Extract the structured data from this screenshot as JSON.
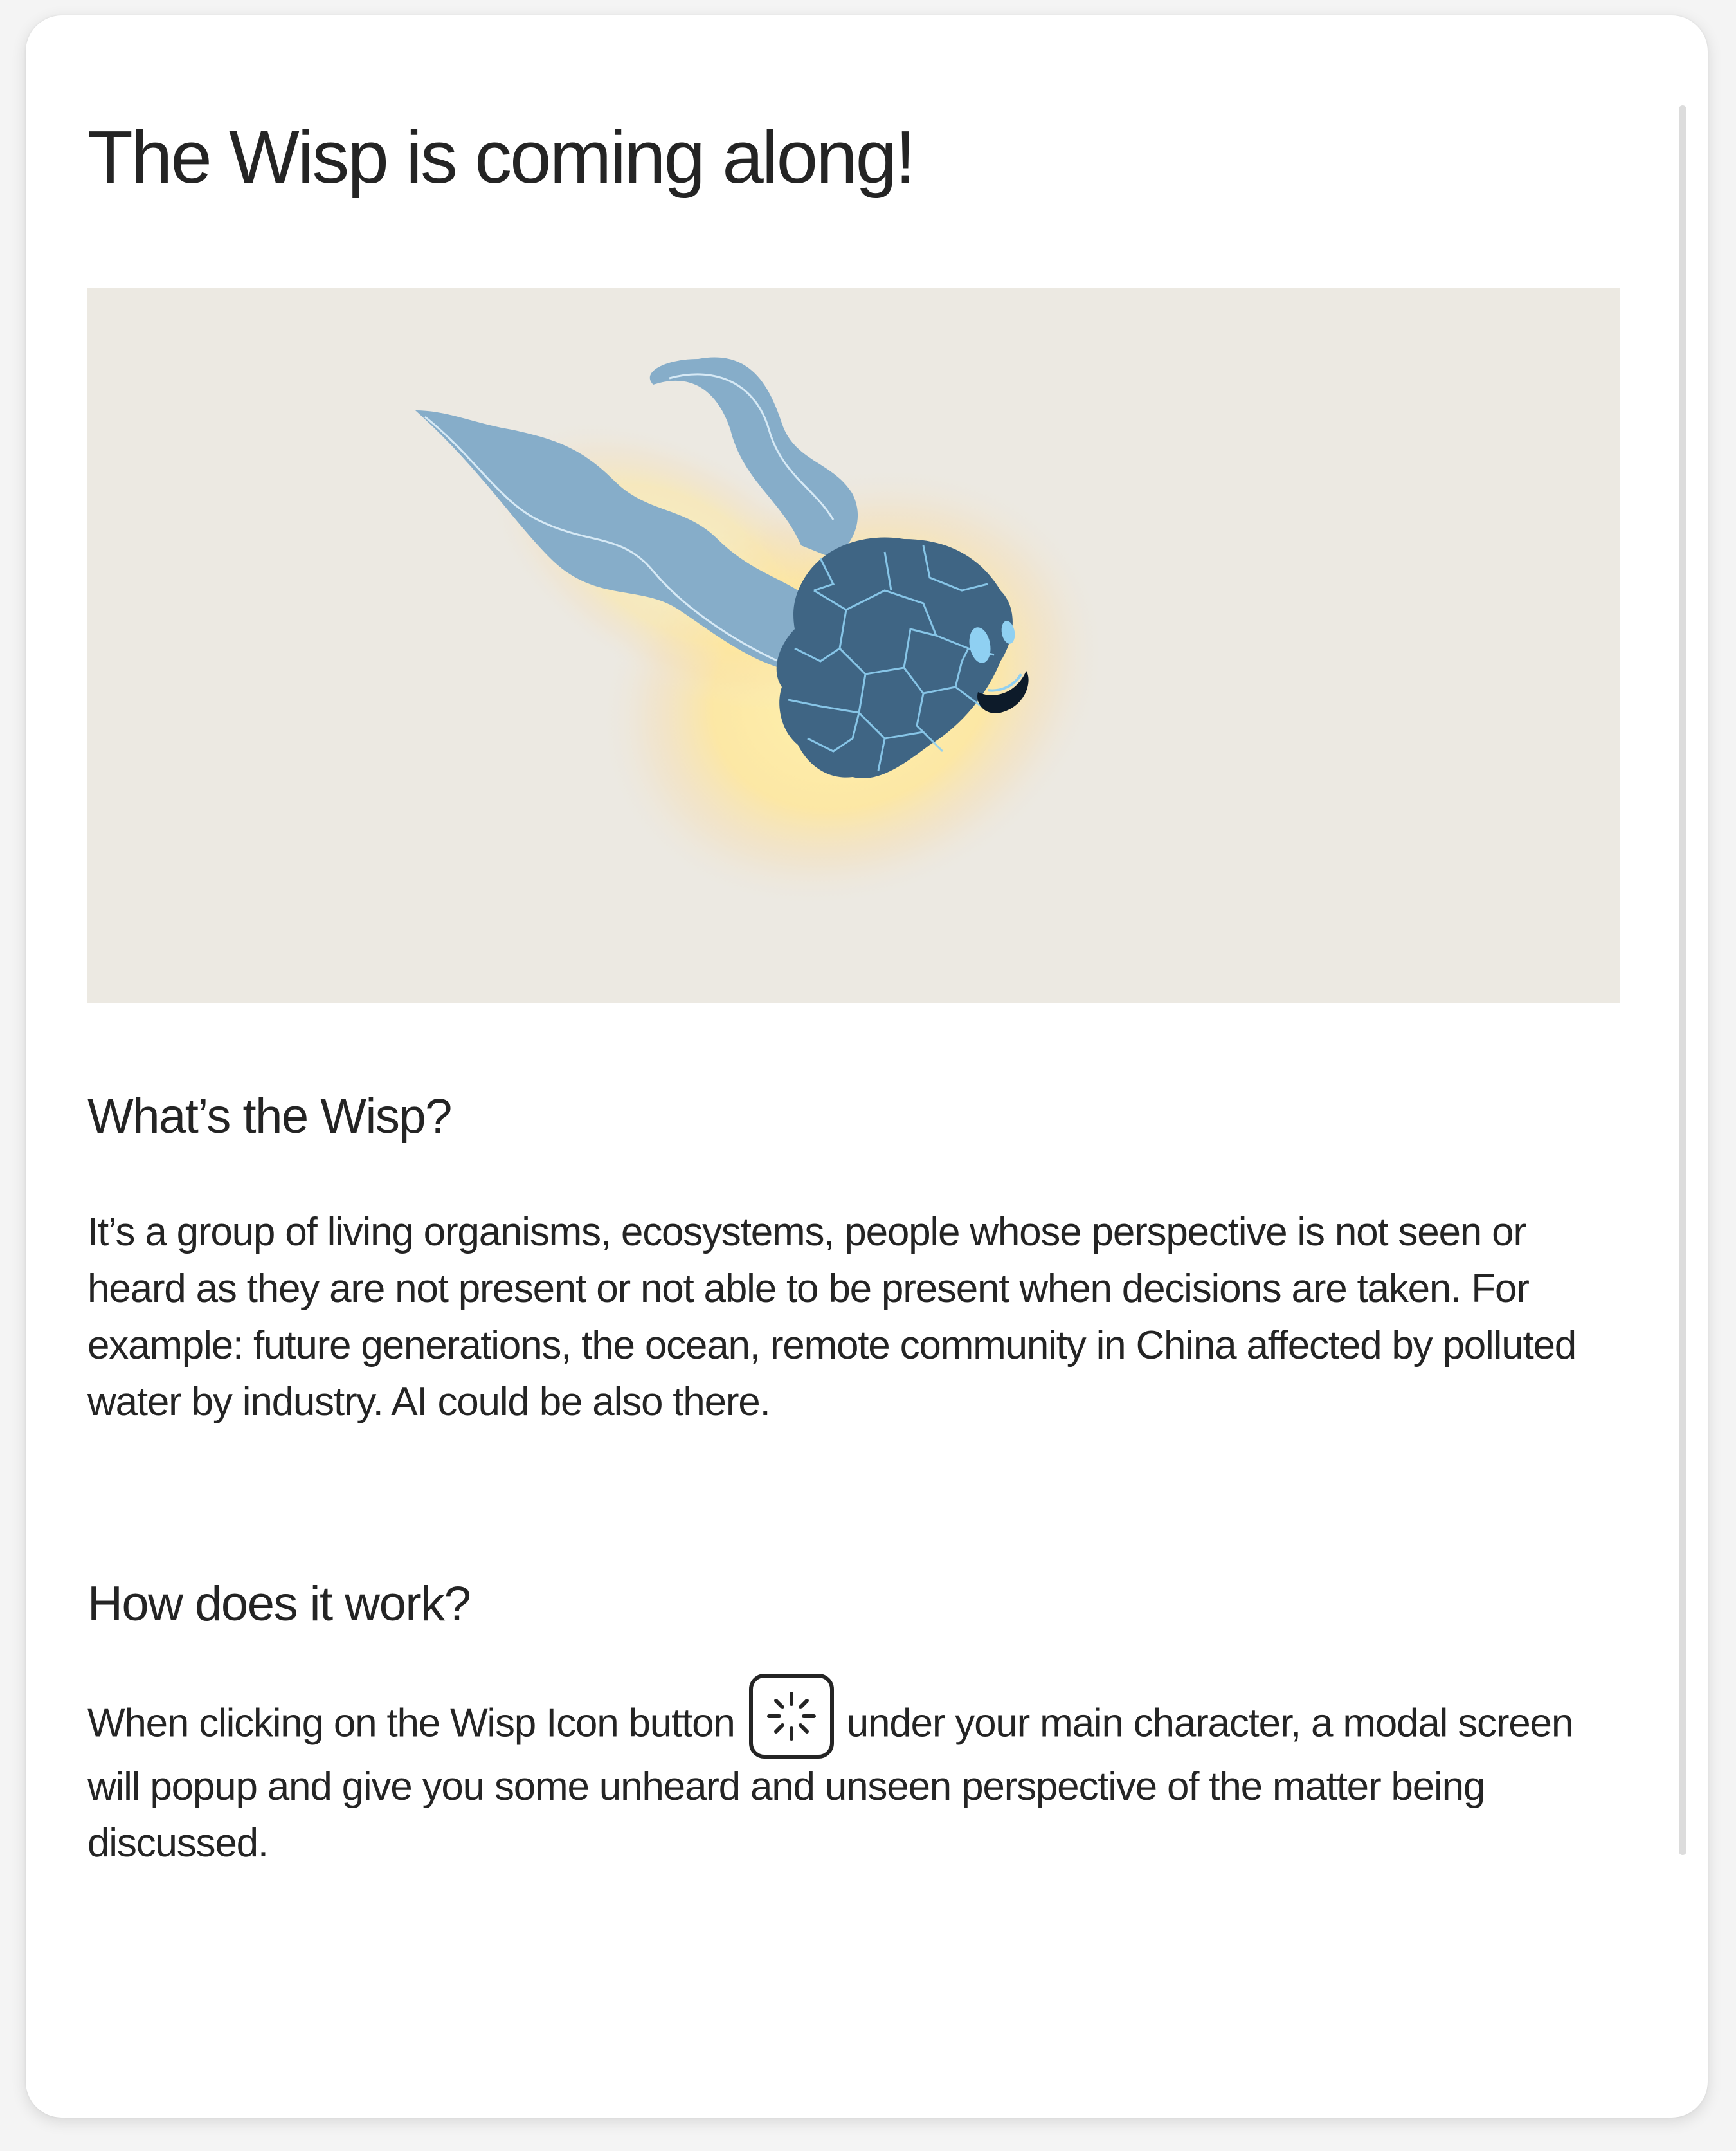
{
  "modal": {
    "title": "The Wisp is coming along!",
    "hero_image": {
      "icon": "wisp-illustration",
      "colors": {
        "background": "#ece9e2",
        "body": "#3f6584",
        "veins": "#8fd0f2",
        "tendrils": "#86adc9",
        "glow": "#fff0a8"
      }
    },
    "section_what": {
      "heading": "What’s the Wisp?",
      "body": "It’s a group of living organisms, ecosystems, people whose perspective is not seen or heard as they are not present or not able to be present when decisions are taken. For example: future generations, the ocean, remote community in China affected by polluted water by industry. AI could be also there."
    },
    "section_how": {
      "heading": "How does it work?",
      "body_before": "When clicking on the Wisp Icon button",
      "button_icon": "wisp-sparkle-icon",
      "body_after": "under your main character, a modal screen will popup and give you some unheard and unseen perspective of the matter being discussed."
    }
  }
}
